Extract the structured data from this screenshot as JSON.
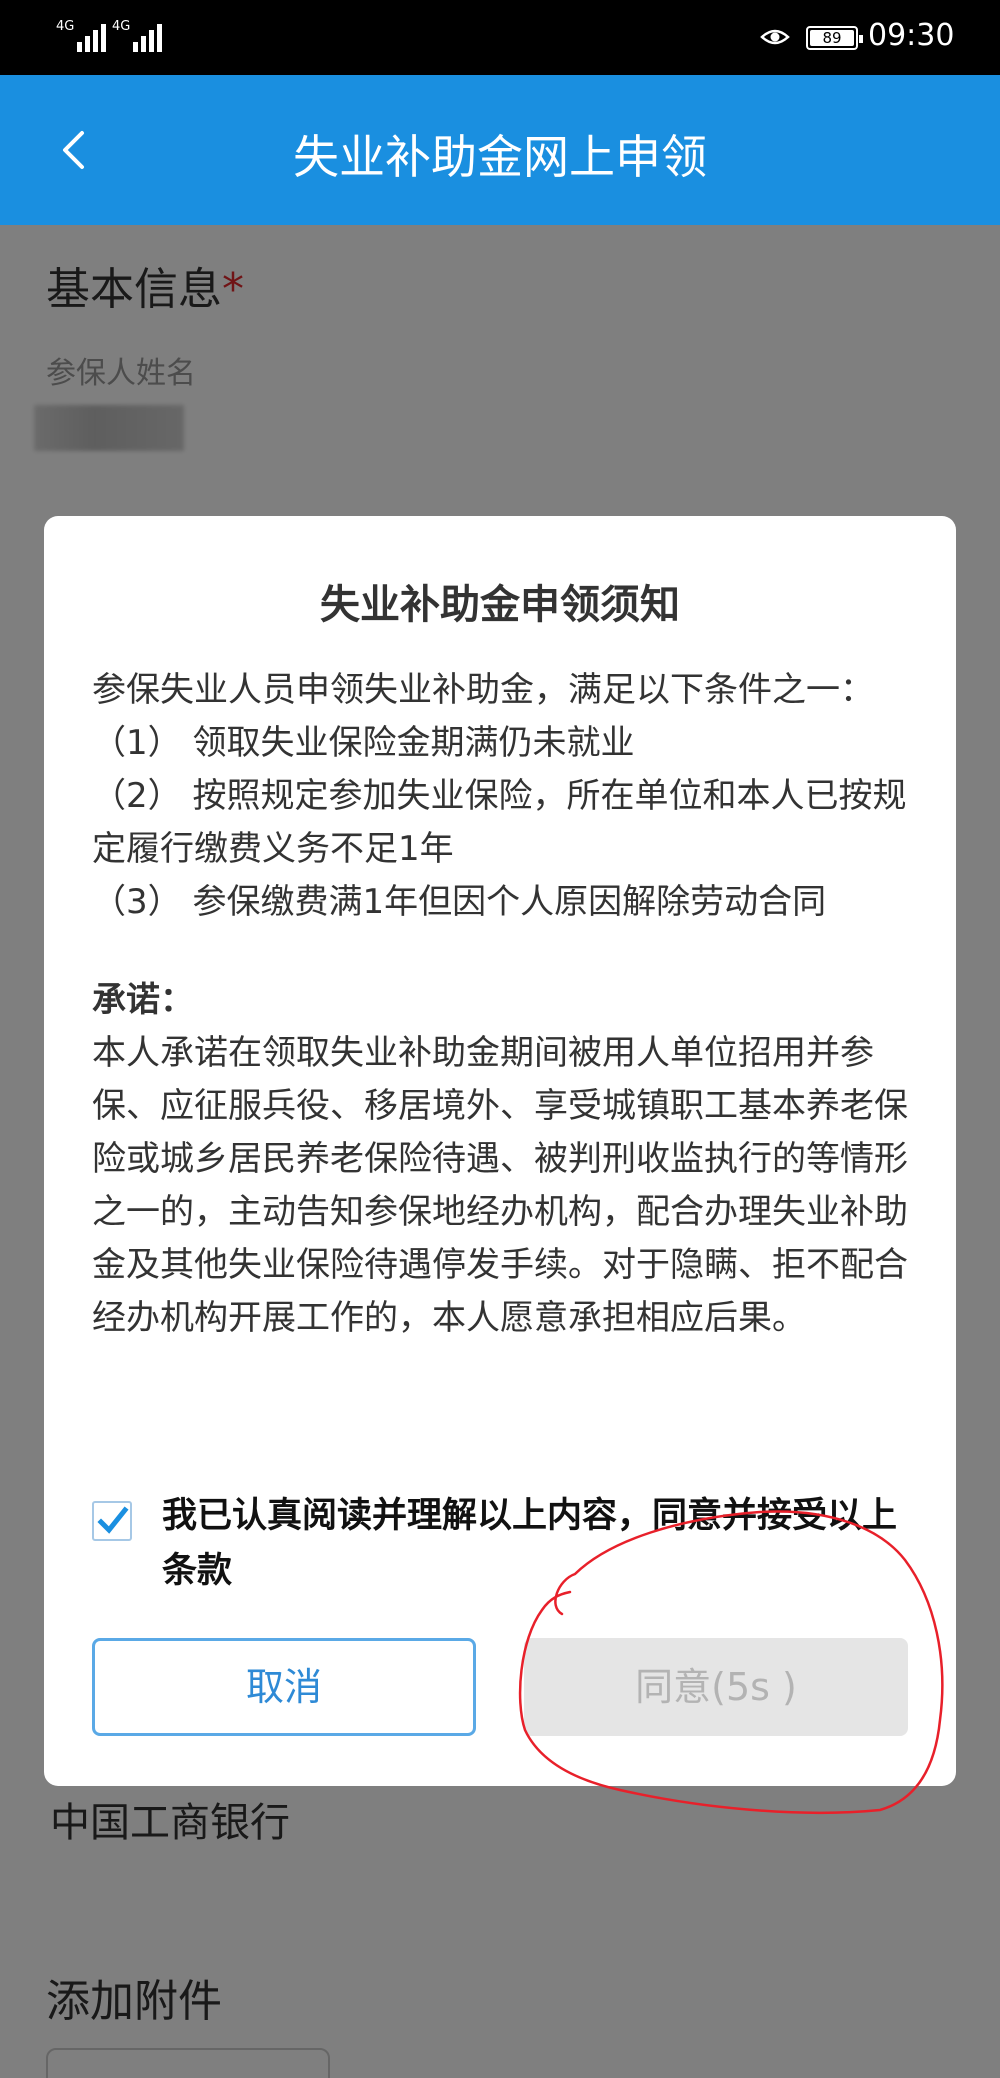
{
  "status_bar": {
    "network_1": "4G",
    "network_2": "4G",
    "battery": "89",
    "time": "09:30"
  },
  "app_bar": {
    "title": "失业补助金网上申领",
    "back_icon": "chevron-left-icon"
  },
  "form": {
    "basic_info_title": "基本信息",
    "required_mark": "*",
    "insured_name_label": "参保人姓名",
    "bank_value": "中国工商银行",
    "attachments_title": "添加附件"
  },
  "dialog": {
    "title": "失业补助金申领须知",
    "intro": "参保失业人员申领失业补助金，满足以下条件之一：",
    "conditions": [
      "（1） 领取失业保险金期满仍未就业",
      "（2） 按照规定参加失业保险，所在单位和本人已按规定履行缴费义务不足1年",
      "（3） 参保缴费满1年但因个人原因解除劳动合同"
    ],
    "promise_title": "承诺：",
    "promise_text": "本人承诺在领取失业补助金期间被用人单位招用并参保、应征服兵役、移居境外、享受城镇职工基本养老保险或城乡居民养老保险待遇、被判刑收监执行的等情形之一的，主动告知参保地经办机构，配合办理失业补助金及其他失业保险待遇停发手续。对于隐瞒、拒不配合经办机构开展工作的，本人愿意承担相应后果。",
    "consent_label": "我已认真阅读并理解以上内容，同意并接受以上条款",
    "consent_checked": true,
    "cancel_label": "取消",
    "agree_label": "同意(5s )"
  },
  "colors": {
    "app_bar": "#1a8fe0",
    "required": "#e0282c",
    "annotation": "#e8202a"
  }
}
